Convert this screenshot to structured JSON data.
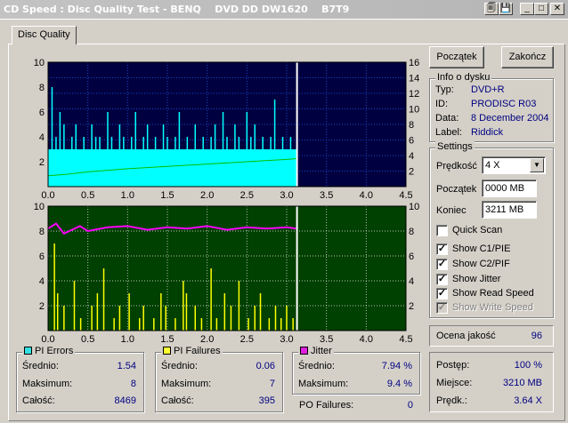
{
  "window": {
    "title": "CD Speed : Disc Quality Test - BENQ    DVD DD DW1620    B7T9",
    "buttons": [
      "🗐",
      "💾",
      "_",
      "□",
      "✕"
    ]
  },
  "tab": {
    "label": "Disc Quality"
  },
  "actions": {
    "start_label": "Początek",
    "stop_label": "Zakończ"
  },
  "disc_info": {
    "title": "Info o dysku",
    "rows": [
      {
        "key": "Typ:",
        "value": "DVD+R"
      },
      {
        "key": "ID:",
        "value": "PRODISC R03"
      },
      {
        "key": "Data:",
        "value": "8 December 2004"
      },
      {
        "key": "Label:",
        "value": "Riddick"
      }
    ]
  },
  "settings": {
    "title": "Settings",
    "speed_label": "Prędkość",
    "speed_value": "4 X",
    "start_label": "Początek",
    "start_value": "0000 MB",
    "end_label": "Koniec",
    "end_value": "3211 MB",
    "checkboxes": [
      {
        "label": "Quick Scan",
        "checked": false,
        "disabled": false
      },
      {
        "label": "Show C1/PIE",
        "checked": true,
        "disabled": false
      },
      {
        "label": "Show C2/PIF",
        "checked": true,
        "disabled": false
      },
      {
        "label": "Show Jitter",
        "checked": true,
        "disabled": false
      },
      {
        "label": "Show Read Speed",
        "checked": true,
        "disabled": false
      },
      {
        "label": "Show Write Speed",
        "checked": true,
        "disabled": true
      }
    ]
  },
  "quality": {
    "label": "Ocena jakość",
    "value": "96"
  },
  "progress": {
    "rows": [
      {
        "key": "Postęp:",
        "value": "100 %"
      },
      {
        "key": "Miejsce:",
        "value": "3210 MB"
      },
      {
        "key": "Prędk.:",
        "value": "3.64 X"
      }
    ]
  },
  "pi_errors": {
    "title": "PI Errors",
    "color": "#33e0e0",
    "rows": [
      {
        "key": "Średnio:",
        "value": "1.54"
      },
      {
        "key": "Maksimum:",
        "value": "8"
      },
      {
        "key": "Całość:",
        "value": "8469"
      }
    ]
  },
  "pi_failures": {
    "title": "PI Failures",
    "color": "#ffff33",
    "rows": [
      {
        "key": "Średnio:",
        "value": "0.06"
      },
      {
        "key": "Maksimum:",
        "value": "7"
      },
      {
        "key": "Całość:",
        "value": "395"
      }
    ]
  },
  "jitter": {
    "title": "Jitter",
    "color": "#e020e0",
    "rows": [
      {
        "key": "Średnio:",
        "value": "7.94 %"
      },
      {
        "key": "Maksimum:",
        "value": "9.4 %"
      }
    ]
  },
  "po_failures": {
    "label": "PO Failures:",
    "value": "0"
  },
  "chart_data": [
    {
      "type": "bar",
      "x_ticks": [
        "0.0",
        "0.5",
        "1.0",
        "1.5",
        "2.0",
        "2.5",
        "3.0",
        "3.5",
        "4.0",
        "4.5"
      ],
      "xlim": [
        0,
        4.5
      ],
      "ylim_left": [
        0,
        10
      ],
      "y_ticks_left": [
        "2",
        "4",
        "6",
        "8",
        "10"
      ],
      "ylim_right": [
        0,
        16
      ],
      "y_ticks_right": [
        "2",
        "4",
        "6",
        "8",
        "10",
        "12",
        "14",
        "16"
      ],
      "end_x": 3.13,
      "background": "#000040",
      "grid_color": "#2060ff",
      "series": [
        {
          "style": "filled-bars",
          "color": "#00ffff",
          "x": [
            0.05,
            0.1,
            0.15,
            0.2,
            0.25,
            0.3,
            0.35,
            0.4,
            0.45,
            0.5,
            0.55,
            0.6,
            0.65,
            0.7,
            0.75,
            0.8,
            0.85,
            0.9,
            0.95,
            1.0,
            1.05,
            1.1,
            1.15,
            1.2,
            1.25,
            1.3,
            1.35,
            1.4,
            1.45,
            1.5,
            1.55,
            1.6,
            1.65,
            1.7,
            1.75,
            1.8,
            1.85,
            1.9,
            1.95,
            2.0,
            2.05,
            2.1,
            2.15,
            2.2,
            2.25,
            2.3,
            2.35,
            2.4,
            2.45,
            2.5,
            2.55,
            2.6,
            2.65,
            2.7,
            2.75,
            2.8,
            2.85,
            2.9,
            2.95,
            3.0,
            3.05,
            3.1
          ],
          "y": [
            8,
            4,
            6,
            5,
            3,
            4,
            5,
            3,
            4,
            3,
            5,
            4,
            4,
            3,
            6,
            4,
            3,
            5,
            4,
            3,
            4,
            6,
            3,
            4,
            5,
            3,
            4,
            3,
            5,
            4,
            3,
            4,
            6,
            3,
            4,
            3,
            5,
            3,
            4,
            3,
            4,
            5,
            3,
            6,
            4,
            3,
            5,
            4,
            3,
            6,
            4,
            5,
            3,
            4,
            3,
            4,
            7,
            3,
            4,
            3,
            4,
            3
          ]
        },
        {
          "style": "line",
          "color": "#00c000",
          "axis": "right",
          "x": [
            0.0,
            0.25,
            0.5,
            1.0,
            1.5,
            2.0,
            2.5,
            3.0,
            3.12
          ],
          "y": [
            1.4,
            1.6,
            1.9,
            2.3,
            2.6,
            2.9,
            3.2,
            3.5,
            3.6
          ]
        }
      ]
    },
    {
      "type": "bar",
      "x_ticks": [
        "0.0",
        "0.5",
        "1.0",
        "1.5",
        "2.0",
        "2.5",
        "3.0",
        "3.5",
        "4.0",
        "4.5"
      ],
      "xlim": [
        0,
        4.5
      ],
      "ylim_left": [
        0,
        10
      ],
      "y_ticks_left": [
        "2",
        "4",
        "6",
        "8",
        "10"
      ],
      "ylim_right": [
        0,
        10
      ],
      "y_ticks_right": [
        "2",
        "4",
        "6",
        "8",
        "10"
      ],
      "end_x": 3.13,
      "background": "#004000",
      "grid_color": "#ffffff",
      "series": [
        {
          "style": "spikes",
          "color": "#ffff00",
          "x": [
            0.08,
            0.12,
            0.2,
            0.33,
            0.41,
            0.55,
            0.62,
            0.7,
            0.83,
            0.9,
            1.02,
            1.15,
            1.2,
            1.33,
            1.42,
            1.48,
            1.6,
            1.7,
            1.74,
            1.85,
            1.93,
            2.05,
            2.12,
            2.22,
            2.3,
            2.4,
            2.52,
            2.6,
            2.67,
            2.78,
            2.86,
            2.93,
            3.0,
            3.08
          ],
          "y": [
            7,
            3,
            2,
            4,
            1,
            2,
            3,
            5,
            1,
            2,
            3,
            1,
            2,
            1,
            3,
            2,
            1,
            4,
            3,
            2,
            1,
            5,
            1,
            3,
            2,
            4,
            1,
            2,
            3,
            1,
            2,
            1,
            2,
            1
          ]
        },
        {
          "style": "line",
          "color": "#ff00ff",
          "axis": "left",
          "x": [
            0.0,
            0.1,
            0.2,
            0.3,
            0.4,
            0.5,
            0.75,
            1.0,
            1.25,
            1.5,
            1.75,
            2.0,
            2.25,
            2.5,
            2.75,
            3.0,
            3.12
          ],
          "y": [
            8.2,
            8.6,
            7.8,
            8.1,
            8.4,
            8.0,
            8.3,
            8.4,
            8.1,
            8.3,
            8.2,
            8.4,
            8.1,
            8.3,
            8.2,
            8.3,
            8.2
          ]
        }
      ]
    }
  ]
}
